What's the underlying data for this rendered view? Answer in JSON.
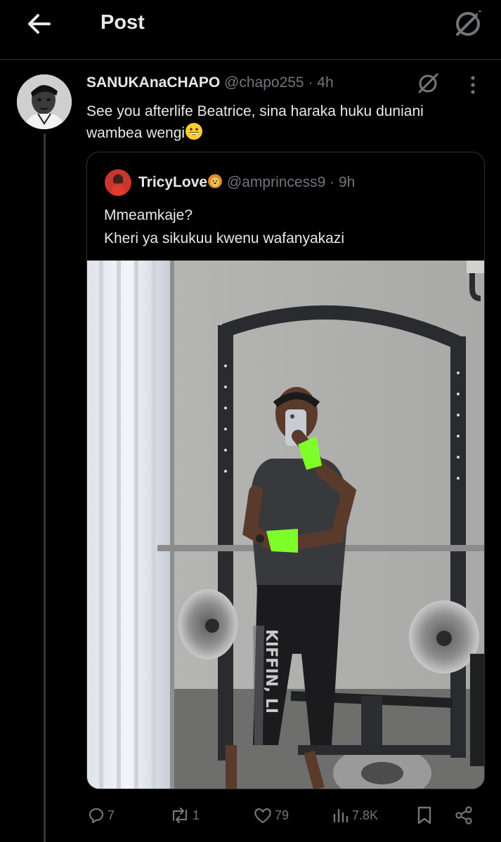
{
  "header": {
    "title": "Post"
  },
  "post": {
    "author_name": "SANUKAnaCHAPO",
    "author_handle": "@chapo255",
    "dot": "·",
    "time": "4h",
    "text_line1": "See you afterlife Beatrice, sina haraka huku duniani",
    "text_line2": "wambea wengi",
    "emoji": "😀"
  },
  "quote": {
    "author_name": "TricyLove",
    "name_emoji": "🦁",
    "author_handle": "@amprincess9",
    "dot": "·",
    "time": "9h",
    "text_line1": "Mmeamkaje?",
    "text_line2": "Kheri ya sikukuu kwenu wafanyakazi",
    "photo_print": "KIFFIN, LI"
  },
  "actions": {
    "replies": "7",
    "reposts": "1",
    "likes": "79",
    "views": "7.8K"
  },
  "icons": {
    "back": "back-arrow-icon",
    "grok": "grok-icon",
    "more": "more-vertical-icon",
    "reply": "reply-icon",
    "repost": "repost-icon",
    "like": "heart-icon",
    "views": "views-icon",
    "bookmark": "bookmark-icon",
    "share": "share-icon"
  },
  "colors": {
    "background": "#000000",
    "text": "#e7e9ea",
    "secondary": "#71767b",
    "border": "#2f3336",
    "glove_green": "#7dff2a"
  }
}
